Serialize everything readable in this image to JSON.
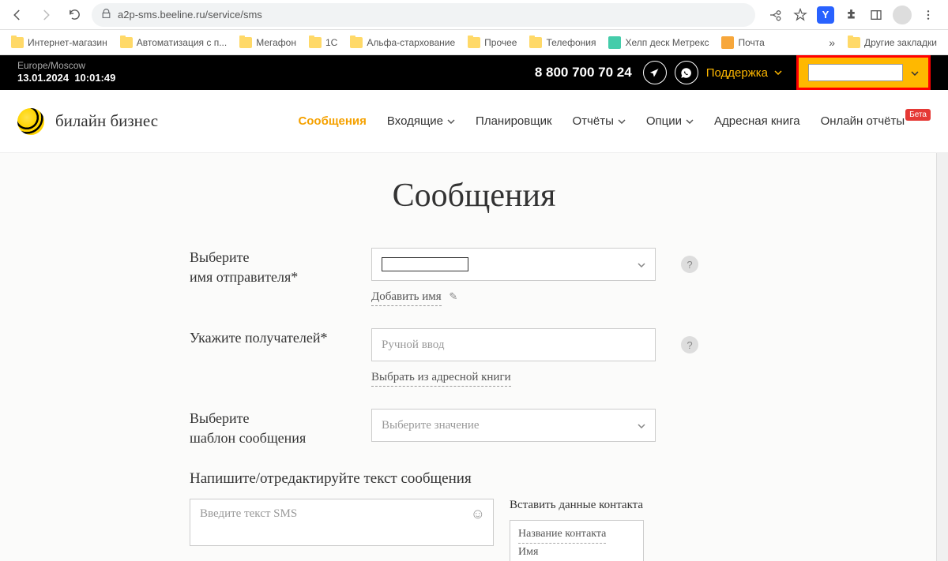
{
  "browser": {
    "url": "a2p-sms.beeline.ru/service/sms",
    "bookmarks": [
      "Интернет-магазин",
      "Автоматизация с п...",
      "Мегафон",
      "1С",
      "Альфа-стархование",
      "Прочее",
      "Телефония",
      "Хелп деск Метрекс",
      "Почта"
    ],
    "other_bookmarks": "Другие закладки"
  },
  "topbar": {
    "timezone": "Europe/Moscow",
    "date": "13.01.2024",
    "time": "10:01:49",
    "phone": "8 800 700 70 24",
    "support": "Поддержка",
    "account_placeholder": ""
  },
  "nav": {
    "brand": "билайн бизнес",
    "items": {
      "messages": "Сообщения",
      "inbox": "Входящие",
      "scheduler": "Планировщик",
      "reports": "Отчёты",
      "options": "Опции",
      "addressbook": "Адресная книга",
      "online_reports": "Онлайн отчёты",
      "beta": "Бета"
    }
  },
  "page": {
    "title": "Сообщения",
    "sender_label": "Выберите\nимя отправителя*",
    "add_name": "Добавить имя",
    "recipients_label": "Укажите получателей*",
    "recipients_placeholder": "Ручной ввод",
    "choose_from_book": "Выбрать из адресной книги",
    "template_label": "Выберите\nшаблон сообщения",
    "template_placeholder": "Выберите значение",
    "write_label": "Напишите/отредактируйте текст сообщения",
    "sms_placeholder": "Введите текст SMS",
    "insert_title": "Вставить данные контакта",
    "insert_options": [
      "Название контакта",
      "Имя"
    ]
  }
}
